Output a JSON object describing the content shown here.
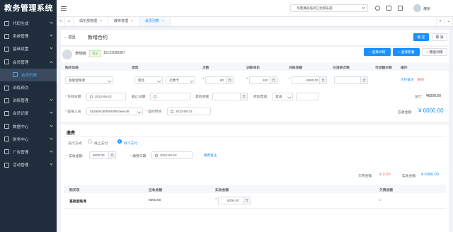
{
  "app": {
    "title": "教务管理系统"
  },
  "sidebar": {
    "items": [
      {
        "label": "代码生成"
      },
      {
        "label": "系统管理"
      },
      {
        "label": "基础设置"
      },
      {
        "label": "会员管理"
      },
      {
        "label": "会员列表"
      },
      {
        "label": "训练频次"
      },
      {
        "label": "训练管理"
      },
      {
        "label": "会员记录"
      },
      {
        "label": "数据中心"
      },
      {
        "label": "财务中心"
      },
      {
        "label": "广告管理"
      },
      {
        "label": "活动管理"
      }
    ]
  },
  "topbar": {
    "store": "华夏舞蹈培训江北俱乐部",
    "user": "演示"
  },
  "tabs": [
    {
      "label": "俱乐部管理"
    },
    {
      "label": "教练管理"
    },
    {
      "label": "会员列表"
    }
  ],
  "header": {
    "back": "返回",
    "title": "新增合约",
    "confirm": "确 定",
    "cancel": "取 消"
  },
  "member": {
    "name": "李晓晓",
    "tag": "会员",
    "phone": "15123098387"
  },
  "actions": {
    "choose_training": "+ 选择训练",
    "choose_package": "+ 选择套餐",
    "recommend": "+ 赠送训练"
  },
  "table1": {
    "headers": [
      "购买训练",
      "类型",
      "次数",
      "训练单价",
      "训练金额",
      "已消耗次数",
      "可退额天数",
      "操作"
    ],
    "row": {
      "training": "基础套路课",
      "type": "新签",
      "card": "次数卡",
      "count": "60",
      "price": "100",
      "amount": "6000.00",
      "op_note": "合约备注",
      "op_delete": "删除"
    }
  },
  "dates": {
    "start_label": "生效日期",
    "start_value": "2022-08-23",
    "end_label": "截止日期",
    "other_label": "其他金额",
    "discount_label": "折扣直减",
    "discount_value": "直减",
    "total_label": "总计:",
    "total_value": "¥6000.00"
  },
  "sign": {
    "staff_label": "签单人员",
    "staff_value": "518ab0c85f5940f9cbeecd6",
    "time_label": "签约时间",
    "time_value": "2022-08-23",
    "receivable_label": "应收金额:",
    "receivable_value": "¥ 6000.00"
  },
  "payment": {
    "title": "缴费",
    "method_label": "支付方式:",
    "online": "线上支付",
    "offline": "线下支付",
    "paid_label": "实收金额:",
    "paid_value": "6000.00",
    "date_label": "缴费日期",
    "date_value": "2022-08-23",
    "note": "缴费备注",
    "owed_label": "欠费金额:",
    "owed_value": "¥ 0.00",
    "received_label": "实收金额:",
    "received_value": "¥ 6000.00"
  },
  "table2": {
    "headers": [
      "购买项",
      "应收金额",
      "实收金额",
      "欠费金额"
    ],
    "row": {
      "item": "基础套路课",
      "receivable": "6000.00",
      "paid": "6000.00",
      "owed": "0"
    }
  },
  "units": {
    "yuan": "元"
  },
  "colors": {
    "accent": "#1890ff",
    "danger": "#f56c6c",
    "sidebar": "#1f2d3d",
    "success": "#67c23a"
  }
}
